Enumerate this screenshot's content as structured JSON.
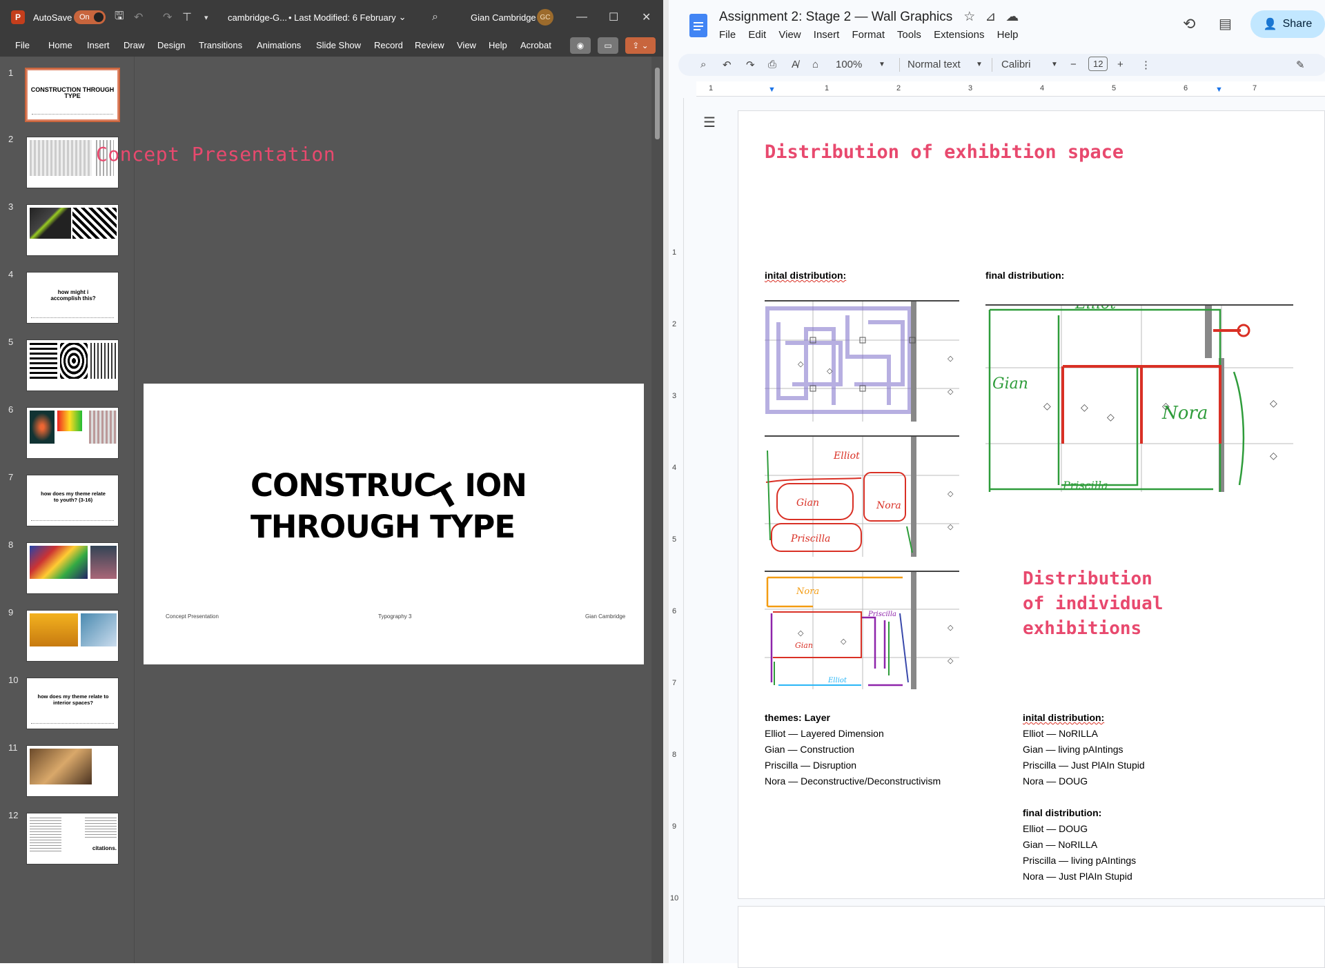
{
  "ppt": {
    "autosave_label": "AutoSave",
    "autosave_state": "On",
    "file_name": "cambridge-G...",
    "last_modified": "• Last Modified: 6 February",
    "user_name": "Gian Cambridge",
    "user_initials": "GC",
    "menu": [
      "File",
      "Home",
      "Insert",
      "Draw",
      "Design",
      "Transitions",
      "Animations",
      "Slide Show",
      "Record",
      "Review",
      "View",
      "Help",
      "Acrobat"
    ],
    "thumbs": [
      {
        "num": "1",
        "text": "CONSTRUCTION THROUGH TYPE"
      },
      {
        "num": "2",
        "text": ""
      },
      {
        "num": "3",
        "text": ""
      },
      {
        "num": "4",
        "text": "how might i accomplish this?"
      },
      {
        "num": "5",
        "text": ""
      },
      {
        "num": "6",
        "text": ""
      },
      {
        "num": "7",
        "text": "how does my theme relate to youth? (3-16)"
      },
      {
        "num": "8",
        "text": ""
      },
      {
        "num": "9",
        "text": ""
      },
      {
        "num": "10",
        "text": "how does my theme relate to interior spaces?"
      },
      {
        "num": "11",
        "text": ""
      },
      {
        "num": "12",
        "text": "citations."
      }
    ],
    "slide": {
      "title_line1_a": "CONSTRUC",
      "title_line1_b": "ION",
      "title_line2": "THROUGH TYPE",
      "footer_left": "Concept Presentation",
      "footer_center": "Typography 3",
      "footer_right": "Gian Cambridge"
    },
    "overlay_text": "Concept Presentation"
  },
  "gdoc": {
    "title": "Assignment 2: Stage 2 — Wall Graphics",
    "menu": [
      "File",
      "Edit",
      "View",
      "Insert",
      "Format",
      "Tools",
      "Extensions",
      "Help"
    ],
    "share_label": "Share",
    "zoom": "100%",
    "style": "Normal text",
    "font": "Calibri",
    "font_size": "12",
    "ruler_marks": [
      "1",
      "1",
      "2",
      "3",
      "4",
      "5",
      "6",
      "7"
    ],
    "vruler_marks": [
      "1",
      "2",
      "3",
      "4",
      "5",
      "6",
      "7",
      "8",
      "9",
      "10"
    ],
    "heading1": "Distribution of exhibition space",
    "heading2": "Distribution of individual exhibitions",
    "initial_label": "inital distribution:",
    "final_label": "final distribution:",
    "sketch_names": {
      "elliot": "Elliot",
      "gian": "Gian",
      "nora": "Nora",
      "priscilla": "Priscilla"
    },
    "themes_heading": "themes:  Layer",
    "themes": [
      "Elliot — Layered Dimension",
      "Gian — Construction",
      "Priscilla — Disruption",
      "Nora — Deconstructive/Deconstructivism"
    ],
    "initial_dist_heading": "inital distribution:",
    "initial_dist": [
      "Elliot — NoRILLA",
      "Gian —  living pAIntings",
      "Priscilla —  Just PlAIn Stupid",
      "Nora — DOUG"
    ],
    "final_dist_heading": "final distribution:",
    "final_dist": [
      "Elliot — DOUG",
      "Gian —  NoRILLA",
      "Priscilla —  living pAIntings",
      "Nora — Just PlAIn Stupid"
    ]
  },
  "colors": {
    "accent_pink": "#e8496e",
    "ppt_orange": "#c8653d",
    "share_blue": "#c2e7ff"
  }
}
